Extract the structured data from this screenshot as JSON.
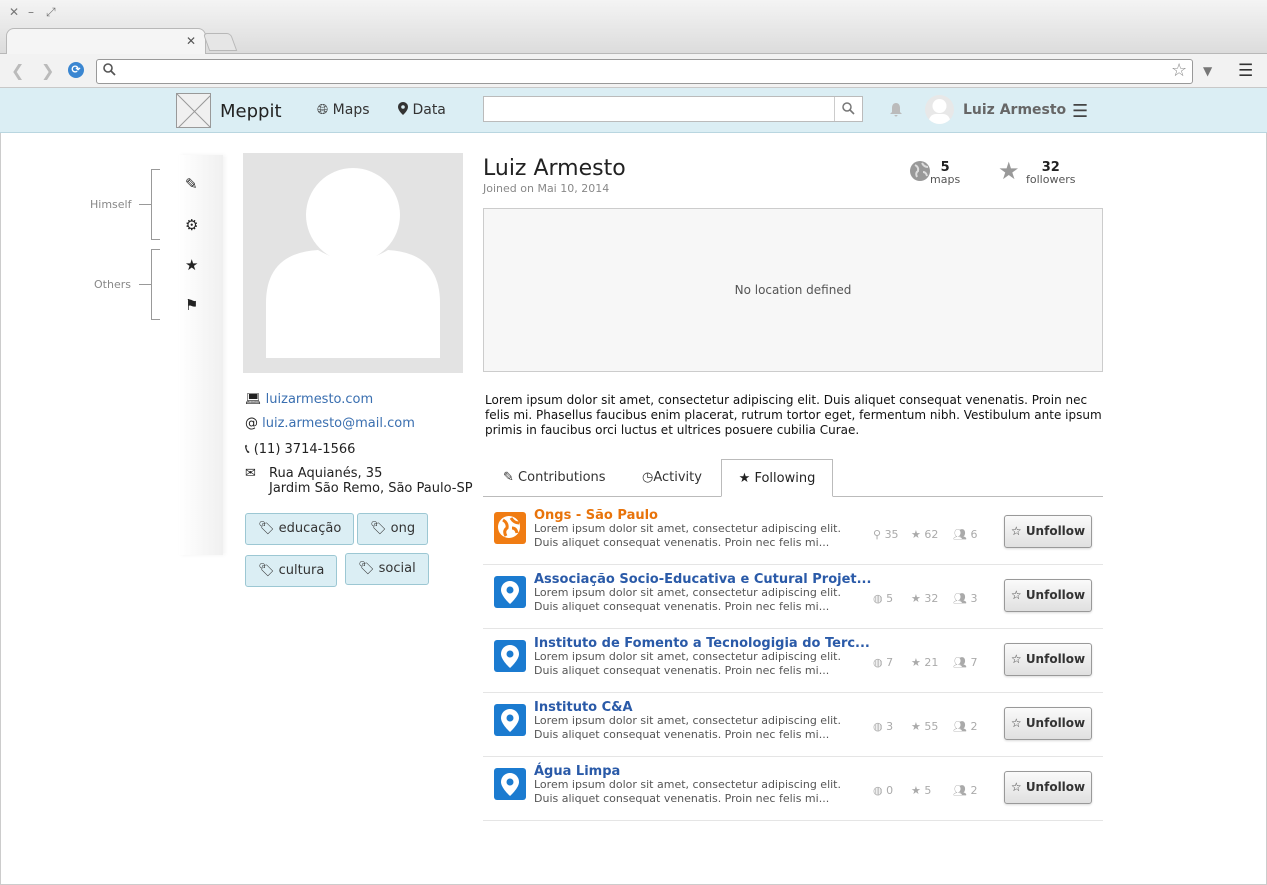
{
  "window": {
    "close": "✕",
    "minimize": "–",
    "maximize": "⤢"
  },
  "browser": {
    "tab_close": "✕",
    "url": "",
    "icons": {
      "back": "back-icon",
      "forward": "forward-icon",
      "reload": "reload-icon",
      "search": "search-icon",
      "bookmark": "star-icon",
      "menu": "hamburger-icon"
    }
  },
  "nav": {
    "brand": "Meppit",
    "links": [
      {
        "label": "Maps",
        "icon": "globe-icon"
      },
      {
        "label": "Data",
        "icon": "map-pin-icon"
      }
    ],
    "search_placeholder": "",
    "user": "Luiz Armesto"
  },
  "sidebar": {
    "groups": [
      {
        "label": "Himself"
      },
      {
        "label": "Others"
      }
    ],
    "icons": [
      "pencil-icon",
      "gear-icon",
      "star-icon",
      "flag-icon"
    ]
  },
  "profile": {
    "name": "Luiz Armesto",
    "joined": "Joined on Mai 10, 2014",
    "website": "luizarmesto.com",
    "email": "luiz.armesto@mail.com",
    "phone": "(11) 3714-1566",
    "address_line1": "Rua Aquianés, 35",
    "address_line2": "Jardim São Remo, São Paulo-SP",
    "tags": [
      "educação",
      "ong",
      "cultura",
      "social"
    ],
    "stats": {
      "maps_count": "5",
      "maps_label": "maps",
      "followers_count": "32",
      "followers_label": "followers"
    },
    "map_message": "No location defined",
    "bio": "Lorem ipsum dolor sit amet, consectetur adipiscing elit. Duis aliquet consequat venenatis. Proin nec felis mi. Phasellus faucibus enim placerat, rutrum tortor eget, fermentum nibh. Vestibulum ante ipsum primis in faucibus orci luctus et ultrices posuere cubilia Curae."
  },
  "tabs": [
    {
      "label": "Contributions",
      "icon": "edit-icon"
    },
    {
      "label": "Activity",
      "icon": "clock-icon"
    },
    {
      "label": "Following",
      "icon": "star-icon",
      "active": true
    }
  ],
  "following": [
    {
      "title": "Ongs - São Paulo",
      "title_color": "#e8730a",
      "icon": "globe-icon",
      "icon_color": "#f07c13",
      "desc1": "Lorem ipsum dolor sit amet, consectetur adipiscing elit.",
      "desc2": "Duis aliquet consequat venenatis. Proin nec felis mi...",
      "s1": "35",
      "s2": "62",
      "s3": "6",
      "button": "Unfollow"
    },
    {
      "title": "Associação Socio-Educativa e Cutural Projet...",
      "title_color": "#2a5aa8",
      "icon": "map-pin-icon",
      "icon_color": "#1b7bd0",
      "desc1": "Lorem ipsum dolor sit amet, consectetur adipiscing elit.",
      "desc2": "Duis aliquet consequat venenatis. Proin nec felis mi...",
      "s1": "5",
      "s2": "32",
      "s3": "3",
      "button": "Unfollow"
    },
    {
      "title": "Instituto de Fomento a Tecnologigia do Terc...",
      "title_color": "#2a5aa8",
      "icon": "map-pin-icon",
      "icon_color": "#1b7bd0",
      "desc1": "Lorem ipsum dolor sit amet, consectetur adipiscing elit.",
      "desc2": "Duis aliquet consequat venenatis. Proin nec felis mi...",
      "s1": "7",
      "s2": "21",
      "s3": "7",
      "button": "Unfollow"
    },
    {
      "title": "Instituto C&A",
      "title_color": "#2a5aa8",
      "icon": "map-pin-icon",
      "icon_color": "#1b7bd0",
      "desc1": "Lorem ipsum dolor sit amet, consectetur adipiscing elit.",
      "desc2": "Duis aliquet consequat venenatis. Proin nec felis mi...",
      "s1": "3",
      "s2": "55",
      "s3": "2",
      "button": "Unfollow"
    },
    {
      "title": "Água Limpa",
      "title_color": "#2a5aa8",
      "icon": "map-pin-icon",
      "icon_color": "#1b7bd0",
      "desc1": "Lorem ipsum dolor sit amet, consectetur adipiscing elit.",
      "desc2": "Duis aliquet consequat venenatis. Proin nec felis mi...",
      "s1": "0",
      "s2": "5",
      "s3": "2",
      "button": "Unfollow"
    }
  ]
}
